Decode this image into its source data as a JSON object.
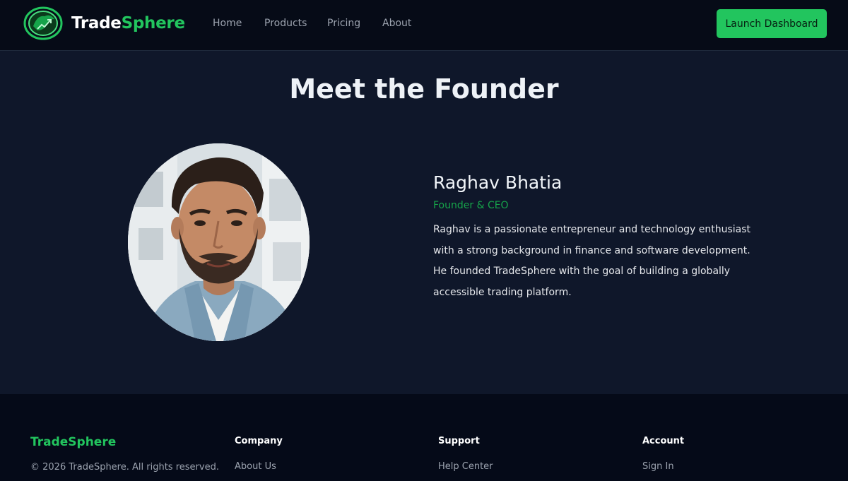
{
  "brand": {
    "name_part1": "Trade",
    "name_part2": "Sphere",
    "icon": "bull-logo-icon"
  },
  "nav": {
    "items": [
      "Home",
      "Products",
      "Pricing",
      "About"
    ]
  },
  "header": {
    "cta_label": "Launch Dashboard"
  },
  "main": {
    "title": "Meet the Founder",
    "founder": {
      "name": "Raghav Bhatia",
      "role": "Founder & CEO",
      "bio": "Raghav is a passionate entrepreneur and technology enthusiast with a strong background in finance and software development. He founded TradeSphere with the goal of building a globally accessible trading platform."
    }
  },
  "footer": {
    "brand": "TradeSphere",
    "copyright": "© 2026 TradeSphere. All rights reserved.",
    "columns": [
      {
        "heading": "Company",
        "link": "About Us"
      },
      {
        "heading": "Support",
        "link": "Help Center"
      },
      {
        "heading": "Account",
        "link": "Sign In"
      }
    ]
  },
  "colors": {
    "accent": "#22c55e",
    "background": "#0f172a",
    "header_bg": "#060b17"
  }
}
